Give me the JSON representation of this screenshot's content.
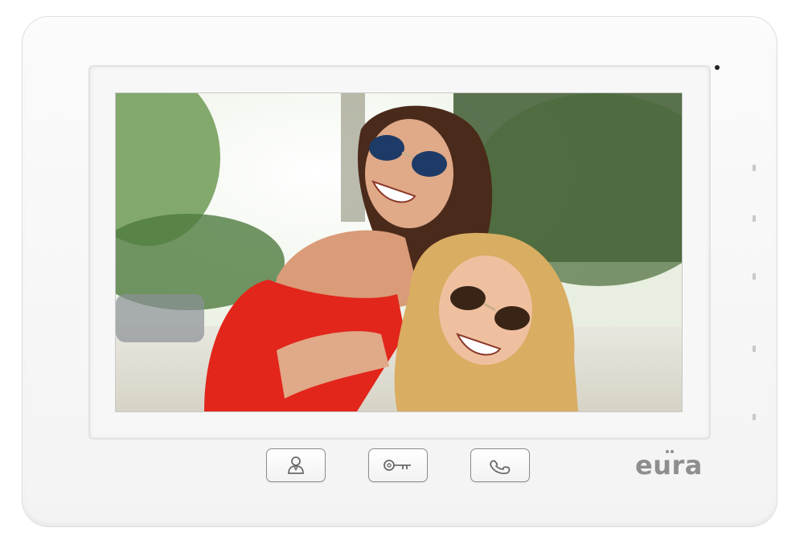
{
  "device": {
    "brand_logo": "eura",
    "screen_content": "video-feed",
    "colors": {
      "housing": "#f5f5f5",
      "key_outline": "#8c8c8c",
      "logo": "#8e8e8e"
    }
  },
  "keys": [
    {
      "name": "monitor-button",
      "icon": "person-icon"
    },
    {
      "name": "unlock-button",
      "icon": "key-icon"
    },
    {
      "name": "call-button",
      "icon": "phone-handset-icon"
    }
  ]
}
